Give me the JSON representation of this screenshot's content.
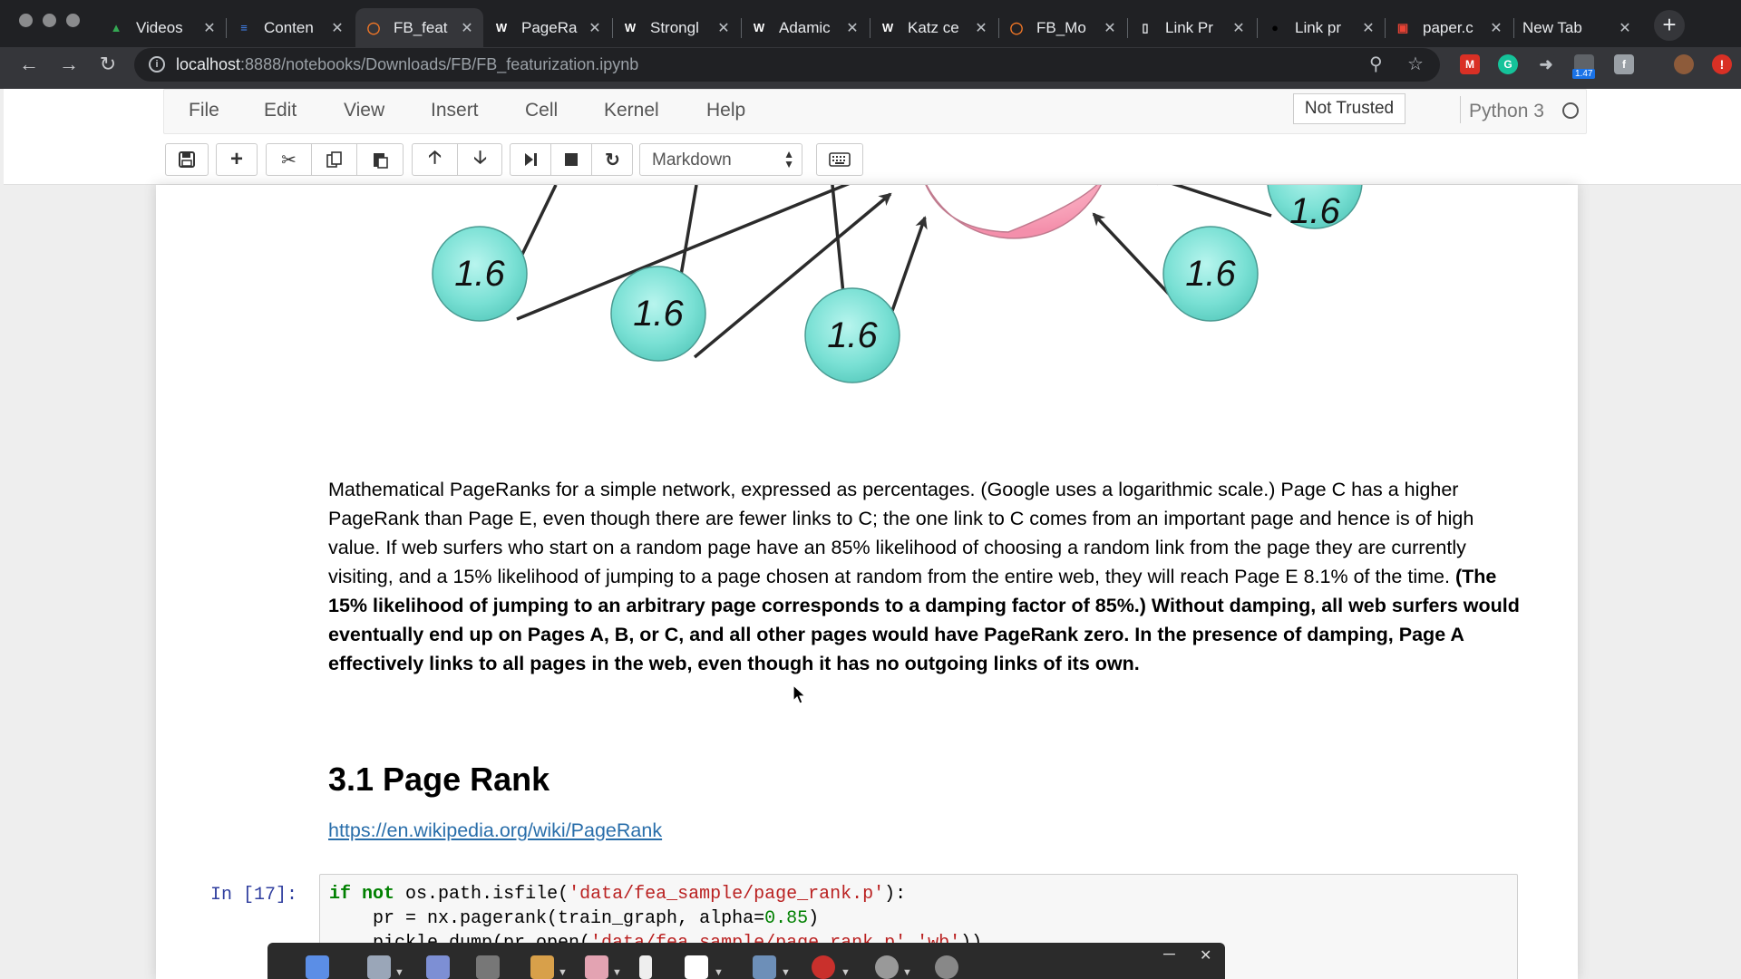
{
  "browser": {
    "tabs": [
      {
        "title": "Videos",
        "favicon": "google-drive-icon",
        "color": "#34a853",
        "active": false
      },
      {
        "title": "Conten",
        "favicon": "google-docs-icon",
        "color": "#4285f4",
        "active": false
      },
      {
        "title": "FB_feat",
        "favicon": "jupyter-icon",
        "color": "#f37726",
        "active": true
      },
      {
        "title": "PageRa",
        "favicon": "wikipedia-icon",
        "color": "#ffffff",
        "active": false
      },
      {
        "title": "Strongl",
        "favicon": "wikipedia-icon",
        "color": "#ffffff",
        "active": false
      },
      {
        "title": "Adamic",
        "favicon": "wikipedia-icon",
        "color": "#ffffff",
        "active": false
      },
      {
        "title": "Katz ce",
        "favicon": "wikipedia-icon",
        "color": "#ffffff",
        "active": false
      },
      {
        "title": "FB_Mo",
        "favicon": "jupyter-icon",
        "color": "#f37726",
        "active": false
      },
      {
        "title": "Link Pr",
        "favicon": "document-icon",
        "color": "#e8eaed",
        "active": false
      },
      {
        "title": "Link pr",
        "favicon": "github-icon",
        "color": "#000000",
        "active": false
      },
      {
        "title": "paper.c",
        "favicon": "pdf-icon",
        "color": "#ea4335",
        "active": false
      },
      {
        "title": "New Tab",
        "favicon": "",
        "color": "",
        "active": false
      }
    ],
    "url_prefix": "localhost",
    "url_rest": ":8888/notebooks/Downloads/FB/FB_featurization.ipynb",
    "extension_badge": "1.47"
  },
  "jupyter": {
    "menu": [
      "File",
      "Edit",
      "View",
      "Insert",
      "Cell",
      "Kernel",
      "Help"
    ],
    "trusted": "Not Trusted",
    "kernel": "Python 3",
    "cell_type": "Markdown"
  },
  "graph": {
    "node_labels": [
      "1.6",
      "1.6",
      "1.6",
      "1.6",
      "1.6",
      "1.6"
    ]
  },
  "caption": {
    "normal": "Mathematical PageRanks for a simple network, expressed as percentages. (Google uses a logarithmic scale.) Page C has a higher PageRank than Page E, even though there are fewer links to C; the one link to C comes from an important page and hence is of high value. If web surfers who start on a random page have an 85% likelihood of choosing a random link from the page they are currently visiting, and a 15% likelihood of jumping to a page chosen at random from the entire web, they will reach Page E 8.1% of the time. ",
    "bold": "(The 15% likelihood of jumping to an arbitrary page corresponds to a damping factor of 85%.) Without damping, all web surfers would eventually end up on Pages A, B, or C, and all other pages would have PageRank zero. In the presence of damping, Page A effectively links to all pages in the web, even though it has no outgoing links of its own."
  },
  "section": {
    "heading": "3.1 Page Rank",
    "link": "https://en.wikipedia.org/wiki/PageRank"
  },
  "code": {
    "prompt": "In [17]:",
    "line1": {
      "kw1": "if",
      "kw2": "not",
      "text1": " os.path.isfile(",
      "str1": "'data/fea_sample/page_rank.p'",
      "text2": "):"
    },
    "line2": {
      "text1": "    pr = nx.pagerank(train_graph, alpha=",
      "num": "0.85",
      "text2": ")"
    },
    "line3": {
      "text1": "    pickle.dump(pr,open(",
      "str1": "'data/fea_sample/page_rank.p'",
      "text2": ",",
      "str2": "'wb'",
      "text3": "))"
    }
  }
}
